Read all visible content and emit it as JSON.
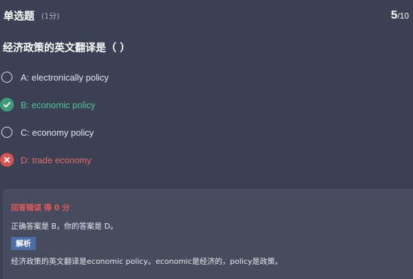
{
  "header": {
    "question_type": "单选题",
    "score": "(1分)",
    "counter_current": "5",
    "counter_total": "/10"
  },
  "question": {
    "text": "经济政策的英文翻译是（ ）"
  },
  "options": [
    {
      "label": "A: electronically policy",
      "state": "neutral",
      "icon": "radio-empty-icon"
    },
    {
      "label": "B: economic policy",
      "state": "correct",
      "icon": "check-circle-icon"
    },
    {
      "label": "C: economy policy",
      "state": "neutral",
      "icon": "radio-empty-icon"
    },
    {
      "label": "D: trade economy",
      "state": "wrong",
      "icon": "x-circle-icon"
    }
  ],
  "feedback": {
    "result": "回答错误 得 0 分",
    "answer_line": "正确答案是 B，你的答案是 D。",
    "analysis_label": "解析",
    "explanation": "经济政策的英文翻译是economic policy。economic是经济的，policy是政策。"
  },
  "colors": {
    "background": "#3b4055",
    "panel": "#464b5e",
    "correct": "#4fc59b",
    "wrong": "#e26b67",
    "analysis_button": "#4a6ea9"
  }
}
